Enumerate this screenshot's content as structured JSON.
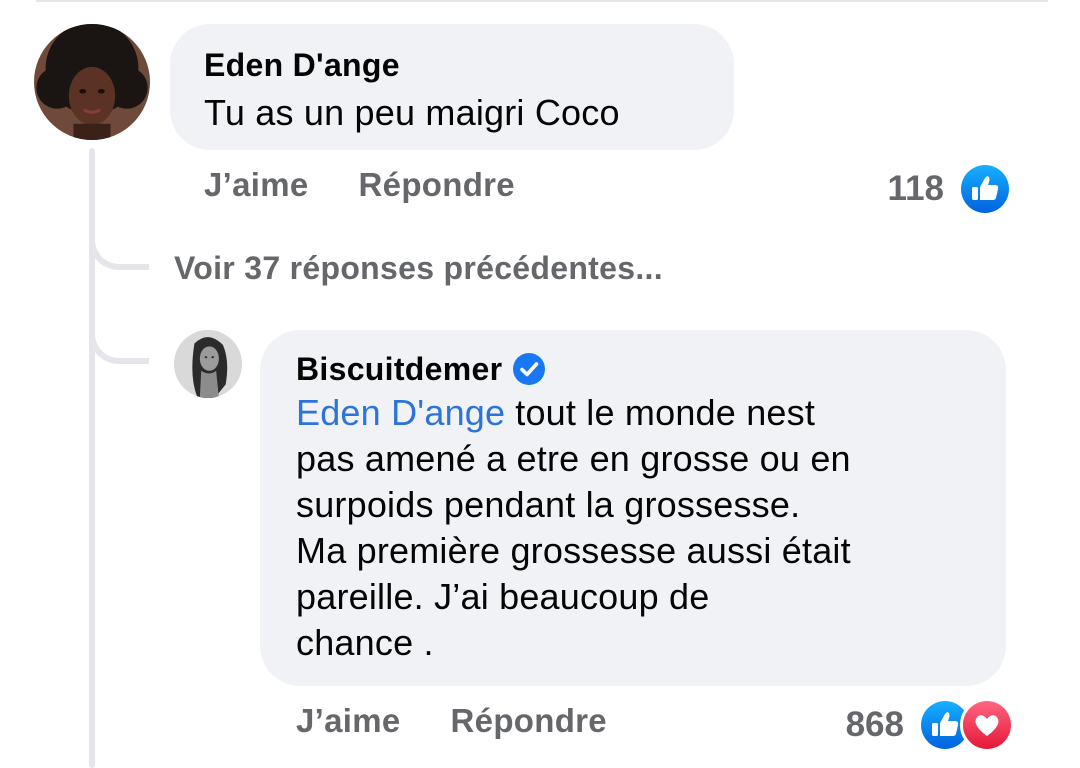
{
  "colors": {
    "bubble_bg": "#f0f2f5",
    "meta_text": "#65676b",
    "mention": "#2d74d9",
    "like_blue": "#1877f2",
    "love_red": "#f33e58",
    "verified_blue": "#1877f2",
    "thread_line": "#e4e6eb"
  },
  "comment": {
    "author": "Eden D'ange",
    "text": "Tu as un peu maigri Coco",
    "actions": {
      "like_label": "J’aime",
      "reply_label": "Répondre"
    },
    "reactions": {
      "count": "118",
      "icons": [
        "like-icon"
      ]
    }
  },
  "view_more": {
    "label": "Voir 37 réponses précédentes..."
  },
  "reply": {
    "author": "Biscuitdemer",
    "verified": true,
    "mention": "Eden D'ange",
    "lines": [
      "tout le monde nest",
      "pas amené a etre en grosse ou en",
      "surpoids pendant la grossesse.",
      "Ma première grossesse aussi était",
      "pareille. J’ai beaucoup de",
      "chance ."
    ],
    "actions": {
      "like_label": "J’aime",
      "reply_label": "Répondre"
    },
    "reactions": {
      "count": "868",
      "icons": [
        "like-icon",
        "love-icon"
      ]
    }
  }
}
